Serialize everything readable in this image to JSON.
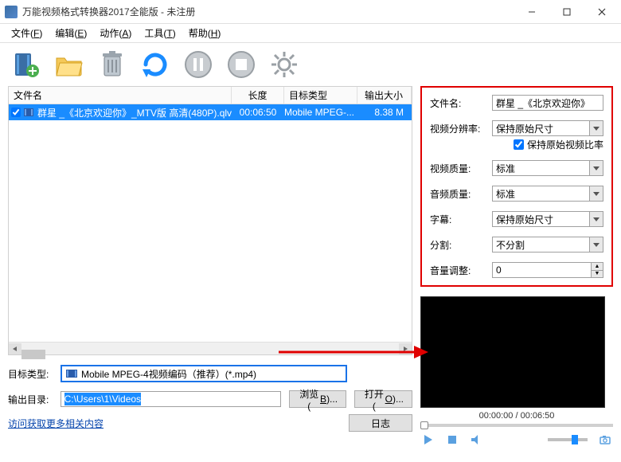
{
  "title": "万能视频格式转换器2017全能版 - 未注册",
  "menu": {
    "file": "文件(",
    "file_accel": "F",
    "file_end": ")",
    "edit": "编辑(",
    "edit_accel": "E",
    "edit_end": ")",
    "action": "动作(",
    "action_accel": "A",
    "action_end": ")",
    "tools": "工具(",
    "tools_accel": "T",
    "tools_end": ")",
    "help": "帮助(",
    "help_accel": "H",
    "help_end": ")"
  },
  "headers": {
    "filename": "文件名",
    "length": "长度",
    "target": "目标类型",
    "size": "输出大小"
  },
  "rows": [
    {
      "name": "群星 _《北京欢迎你》_MTV版 高清(480P).qlv",
      "length": "00:06:50",
      "target": "Mobile MPEG-...",
      "size": "8.38 M",
      "checked": true
    }
  ],
  "bottom": {
    "target_label": "目标类型:",
    "target_value": "Mobile MPEG-4视频编码（推荐）(*.mp4)",
    "output_label": "输出目录:",
    "output_value": "C:\\Users\\1\\Videos",
    "browse": "浏览(",
    "browse_accel": "B",
    "browse_end": ")...",
    "open": "打开(",
    "open_accel": "O",
    "open_end": ")...",
    "link": "访问获取更多相关内容",
    "log": "日志"
  },
  "settings": {
    "filename_label": "文件名:",
    "filename_value": "群星 _《北京欢迎你》",
    "res_label": "视频分辨率:",
    "res_value": "保持原始尺寸",
    "keep_ratio_label": "保持原始视频比率",
    "keep_ratio_checked": true,
    "vquality_label": "视频质量:",
    "vquality_value": "标准",
    "aquality_label": "音频质量:",
    "aquality_value": "标准",
    "subtitle_label": "字幕:",
    "subtitle_value": "保持原始尺寸",
    "split_label": "分割:",
    "split_value": "不分割",
    "volume_label": "音量调整:",
    "volume_value": "0"
  },
  "preview": {
    "time": "00:00:00 / 00:06:50"
  },
  "colors": {
    "selection": "#1a8cff",
    "highlight_border": "#e00000",
    "link": "#0645ad"
  }
}
